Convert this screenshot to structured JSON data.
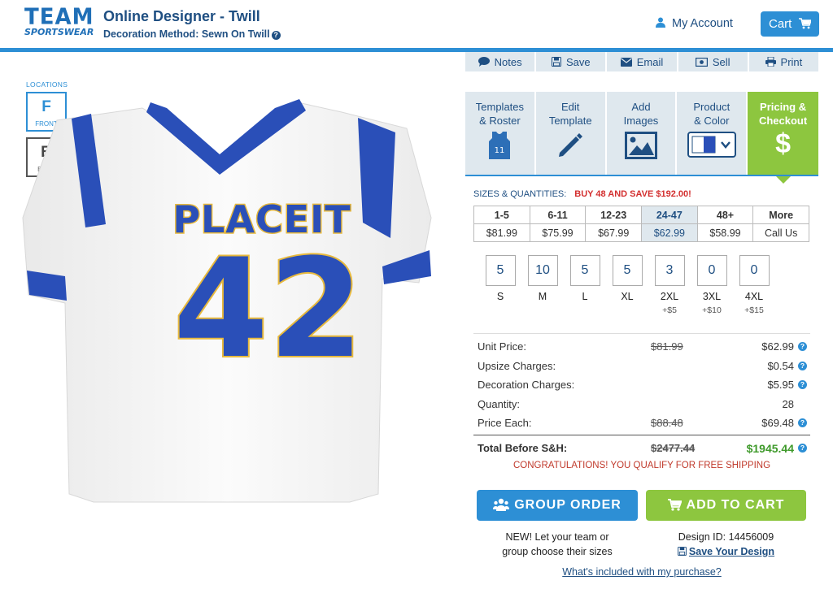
{
  "header": {
    "logo_line1": "TEAM",
    "logo_line2": "SPORTSWEAR",
    "title": "Online Designer - Twill",
    "subtitle": "Decoration Method: Sewn On Twill",
    "account_label": "My Account",
    "cart_label": "Cart"
  },
  "toolbar": {
    "notes": "Notes",
    "save": "Save",
    "email": "Email",
    "sell": "Sell",
    "print": "Print"
  },
  "locations": {
    "label": "LOCATIONS",
    "front_letter": "F",
    "front_label": "FRONT",
    "back_letter": "B",
    "back_label": "BACK"
  },
  "jersey": {
    "name_text": "PLACEIT",
    "number_text": "42",
    "body_color": "#f7f7f7",
    "trim_color": "#2a4fb8",
    "outline_color": "#e7b93d"
  },
  "tabs": {
    "templates_roster": [
      "Templates",
      "& Roster"
    ],
    "roster_number": "11",
    "edit_template": [
      "Edit",
      "Template"
    ],
    "add_images": [
      "Add",
      "Images"
    ],
    "product_color": [
      "Product",
      "& Color"
    ],
    "pricing_checkout": [
      "Pricing &",
      "Checkout"
    ],
    "pricing_symbol": "$"
  },
  "sizes": {
    "label": "SIZES & QUANTITIES:",
    "promo": "BUY 48 AND SAVE $192.00!"
  },
  "price_table": {
    "headers": [
      "1-5",
      "6-11",
      "12-23",
      "24-47",
      "48+",
      "More"
    ],
    "values": [
      "$81.99",
      "$75.99",
      "$67.99",
      "$62.99",
      "$58.99",
      "Call Us"
    ],
    "highlight_index": 3
  },
  "quantities": [
    {
      "size": "S",
      "qty": "5",
      "extra": ""
    },
    {
      "size": "M",
      "qty": "10",
      "extra": ""
    },
    {
      "size": "L",
      "qty": "5",
      "extra": ""
    },
    {
      "size": "XL",
      "qty": "5",
      "extra": ""
    },
    {
      "size": "2XL",
      "qty": "3",
      "extra": "+$5"
    },
    {
      "size": "3XL",
      "qty": "0",
      "extra": "+$10"
    },
    {
      "size": "4XL",
      "qty": "0",
      "extra": "+$15"
    }
  ],
  "summary": {
    "unit_price_label": "Unit Price:",
    "unit_price_old": "$81.99",
    "unit_price": "$62.99",
    "upsize_label": "Upsize Charges:",
    "upsize": "$0.54",
    "decoration_label": "Decoration Charges:",
    "decoration": "$5.95",
    "quantity_label": "Quantity:",
    "quantity": "28",
    "price_each_label": "Price Each:",
    "price_each_old": "$88.48",
    "price_each": "$69.48",
    "total_label": "Total Before S&H:",
    "total_old": "$2477.44",
    "total": "$1945.44",
    "help_icon": "?"
  },
  "congrats": "CONGRATULATIONS! YOU QUALIFY FOR FREE SHIPPING",
  "actions": {
    "group_order": "GROUP ORDER",
    "add_to_cart": "ADD TO CART",
    "group_note_1": "NEW! Let your team or",
    "group_note_2": "group choose their sizes",
    "design_id": "Design ID: 14456009",
    "save_design": "Save Your Design",
    "included_link": "What's included with my purchase?"
  }
}
